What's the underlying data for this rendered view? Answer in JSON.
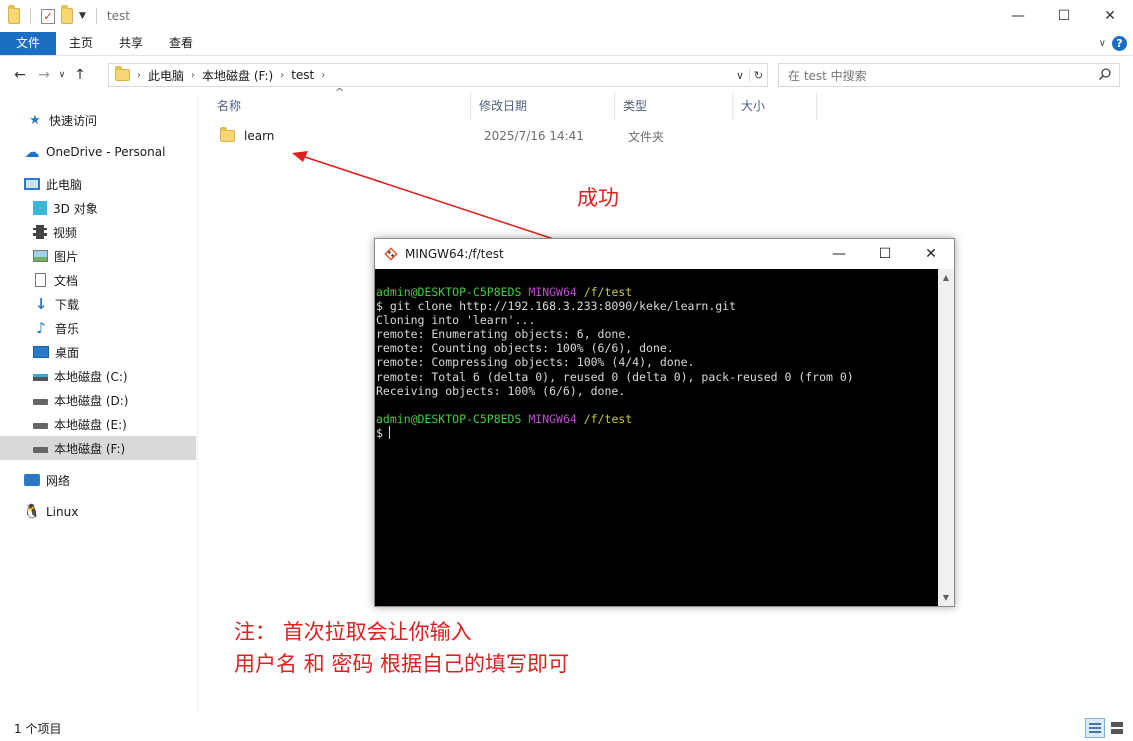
{
  "window": {
    "title": "test",
    "controls": {
      "minimize": "—",
      "maximize": "☐",
      "close": "✕"
    }
  },
  "ribbon": {
    "tabs": [
      "文件",
      "主页",
      "共享",
      "查看"
    ],
    "help": "?"
  },
  "address": {
    "crumbs": [
      "此电脑",
      "本地磁盘 (F:)",
      "test"
    ]
  },
  "search": {
    "placeholder": "在 test 中搜索"
  },
  "sidebar": {
    "items": [
      {
        "label": "快速访问",
        "icon": "star-icon"
      },
      {
        "label": "OneDrive - Personal",
        "icon": "cloud-icon"
      },
      {
        "label": "此电脑",
        "icon": "computer-icon"
      },
      {
        "label": "3D 对象",
        "icon": "cube-icon"
      },
      {
        "label": "视频",
        "icon": "film-icon"
      },
      {
        "label": "图片",
        "icon": "picture-icon"
      },
      {
        "label": "文档",
        "icon": "document-icon"
      },
      {
        "label": "下载",
        "icon": "download-icon"
      },
      {
        "label": "音乐",
        "icon": "music-icon"
      },
      {
        "label": "桌面",
        "icon": "desktop-icon"
      },
      {
        "label": "本地磁盘 (C:)",
        "icon": "drive-icon"
      },
      {
        "label": "本地磁盘 (D:)",
        "icon": "drive-icon"
      },
      {
        "label": "本地磁盘 (E:)",
        "icon": "drive-icon"
      },
      {
        "label": "本地磁盘 (F:)",
        "icon": "drive-icon",
        "selected": true
      },
      {
        "label": "网络",
        "icon": "network-icon"
      },
      {
        "label": "Linux",
        "icon": "penguin-icon"
      }
    ]
  },
  "columns": [
    "名称",
    "修改日期",
    "类型",
    "大小"
  ],
  "files": [
    {
      "name": "learn",
      "modified": "2025/7/16 14:41",
      "type": "文件夹",
      "size": ""
    }
  ],
  "annotations": {
    "success": "成功",
    "note_line1": "注：  首次拉取会让你输入",
    "note_line2": "用户名 和 密码 根据自己的填写即可",
    "arrow_color": "#e02020"
  },
  "terminal": {
    "title": "MINGW64:/f/test",
    "prompt": {
      "user": "admin@DESKTOP-C5P8EDS",
      "shell": "MINGW64",
      "path": "/f/test"
    },
    "command": "$ git clone http://192.168.3.233:8090/keke/learn.git",
    "output": [
      "Cloning into 'learn'...",
      "remote: Enumerating objects: 6, done.",
      "remote: Counting objects: 100% (6/6), done.",
      "remote: Compressing objects: 100% (4/4), done.",
      "remote: Total 6 (delta 0), reused 0 (delta 0), pack-reused 0 (from 0)",
      "Receiving objects: 100% (6/6), done."
    ],
    "final_prompt_symbol": "$"
  },
  "status": {
    "item_count": "1 个项目"
  }
}
